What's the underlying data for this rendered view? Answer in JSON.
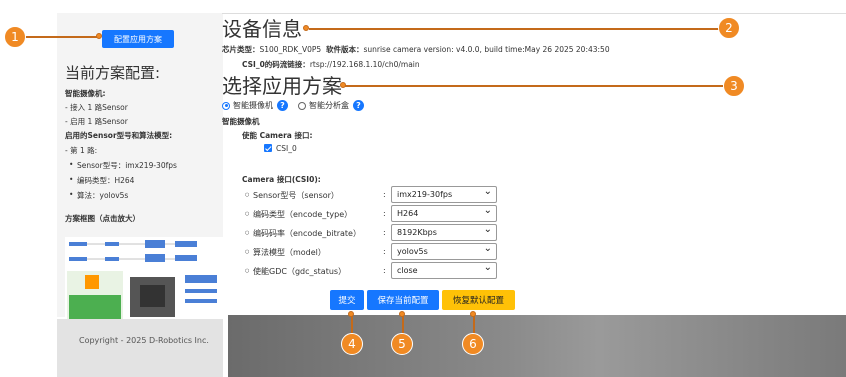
{
  "sidebar": {
    "config_button": "配置应用方案",
    "heading": "当前方案配置:",
    "camera_title": "智能摄像机:",
    "line1": "- 接入 1 路Sensor",
    "line2": "- 启用 1 路Sensor",
    "model_title": "启用的Sensor型号和算法模型:",
    "route": "- 第 1 路:",
    "items": [
      "Sensor型号：imx219-30fps",
      "编码类型：H264",
      "算法：yolov5s"
    ],
    "diagram_title": "方案框图（点击放大）"
  },
  "footer": {
    "copyright": "Copyright - 2025 D-Robotics Inc."
  },
  "device": {
    "title": "设备信息",
    "chip_label": "芯片类型：",
    "chip_value": "S100_RDK_V0P5",
    "sw_label": "软件版本：",
    "sw_value": "sunrise camera version: v4.0.0, build time:May 26 2025 20:43:50",
    "stream_label": "CSI_0的码流链接：",
    "stream_value": "rtsp://192.168.1.10/ch0/main"
  },
  "app": {
    "title": "选择应用方案",
    "opt_camera": "智能摄像机",
    "opt_box": "智能分析盒",
    "help_glyph": "?",
    "section": "智能摄像机",
    "enable_label": "使能 Camera 接口:",
    "csi_label": "CSI_0",
    "iface_title": "Camera 接口(CSI0):",
    "fields": [
      {
        "label": "Sensor型号（sensor）",
        "value": "imx219-30fps"
      },
      {
        "label": "编码类型（encode_type）",
        "value": "H264"
      },
      {
        "label": "编码码率（encode_bitrate）",
        "value": "8192Kbps"
      },
      {
        "label": "算法模型（model）",
        "value": "yolov5s"
      },
      {
        "label": "使能GDC（gdc_status）",
        "value": "close"
      }
    ],
    "colon": ":",
    "submit": "提交",
    "save": "保存当前配置",
    "reset": "恢复默认配置"
  },
  "annotations": [
    "1",
    "2",
    "3",
    "4",
    "5",
    "6"
  ],
  "colors": {
    "accent": "#1677ff",
    "warning": "#ffc107",
    "annotation": "#f08a24"
  }
}
